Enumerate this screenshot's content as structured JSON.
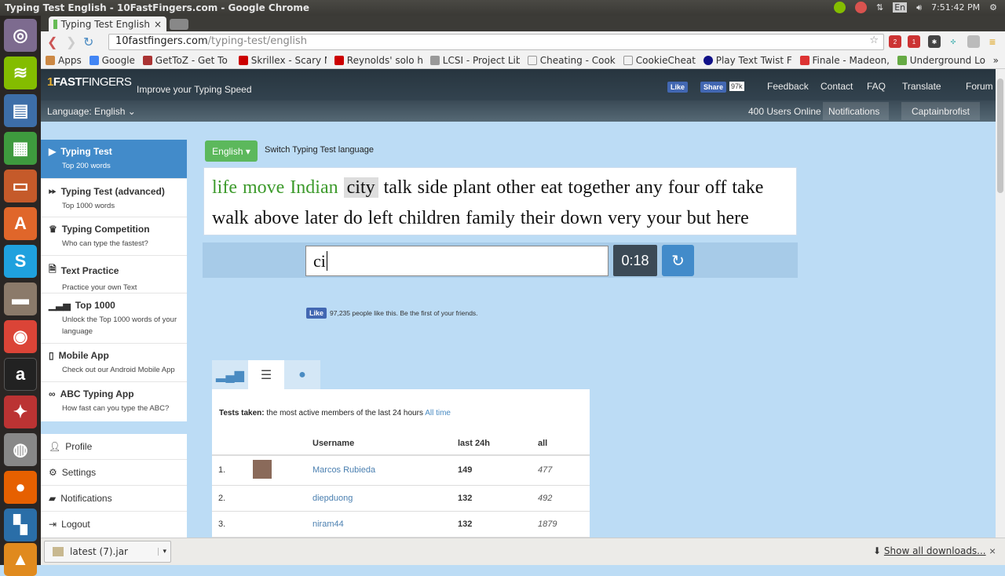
{
  "os": {
    "window_title": "Typing Test English - 10FastFingers.com - Google Chrome",
    "time": "7:51:42 PM",
    "keyboard": "En"
  },
  "browser": {
    "tab_title": "Typing Test English",
    "url_host": "10fastfingers.com",
    "url_path": "/typing-test/english",
    "ext_badges": [
      "2",
      "1"
    ],
    "bookmarks": [
      "Apps",
      "Google",
      "GetToZ - Get To Z",
      "Skrillex - Scary M",
      "Reynolds' solo h",
      "LCSI - Project Lib",
      "Cheating - Cooki",
      "CookieCheat",
      "Play Text Twist F",
      "Finale - Madeon,",
      "Underground Lo"
    ],
    "more": "»"
  },
  "header": {
    "tagline": "Improve your Typing Speed",
    "logo": "10FASTFINGERS",
    "fb_like": "Like",
    "fb_share": "Share",
    "fb_count": "97k",
    "nav": [
      "Feedback",
      "Contact",
      "FAQ",
      "Translate",
      "Forum"
    ],
    "language": "Language: English",
    "users_online": "400 Users Online",
    "notifications": "Notifications",
    "username": "Captainbrofist"
  },
  "sidebar": {
    "items": [
      {
        "title": "Typing Test",
        "desc": "Top 200 words",
        "icon": "play-icon",
        "active": true
      },
      {
        "title": "Typing Test (advanced)",
        "desc": "Top 1000 words",
        "icon": "fast-forward-icon"
      },
      {
        "title": "Typing Competition",
        "desc": "Who can type the fastest?",
        "icon": "trophy-icon"
      },
      {
        "title": "Text Practice",
        "desc": "Practice your own Text",
        "icon": "document-icon"
      },
      {
        "title": "Top 1000",
        "desc": "Unlock the Top 1000 words of your language",
        "icon": "signal-icon"
      },
      {
        "title": "Mobile App",
        "desc": "Check out our Android Mobile App",
        "icon": "phone-icon"
      },
      {
        "title": "ABC Typing App",
        "desc": "How fast can you type the ABC?",
        "icon": "gamepad-icon"
      }
    ],
    "user_menu": [
      "Profile",
      "Settings",
      "Notifications",
      "Logout"
    ]
  },
  "test": {
    "language_button": "English",
    "switch_label": "Switch Typing Test language",
    "typed_words": [
      "life",
      "move",
      "Indian"
    ],
    "current_word": "city",
    "line1_rest": "talk side plant other eat together any four off take",
    "line2": "walk above later do left children family their down very your but here",
    "input_value": "ci",
    "timer": "0:18",
    "correct_color": "#3c9a2b"
  },
  "fb": {
    "like": "Like",
    "text": "97,235 people like this. Be the first of your friends."
  },
  "ranking": {
    "label_bold": "Tests taken:",
    "label": "the most active members of the last 24 hours",
    "link": "All time",
    "columns": [
      "",
      "",
      "Username",
      "last 24h",
      "all"
    ],
    "rows": [
      {
        "rank": "1.",
        "user": "Marcos Rubieda",
        "last24h": "149",
        "all": "477",
        "avatar": true
      },
      {
        "rank": "2.",
        "user": "diepduong",
        "last24h": "132",
        "all": "492"
      },
      {
        "rank": "3.",
        "user": "niram44",
        "last24h": "132",
        "all": "1879"
      }
    ]
  },
  "downloads": {
    "file": "latest (7).jar",
    "show_all": "Show all downloads..."
  }
}
